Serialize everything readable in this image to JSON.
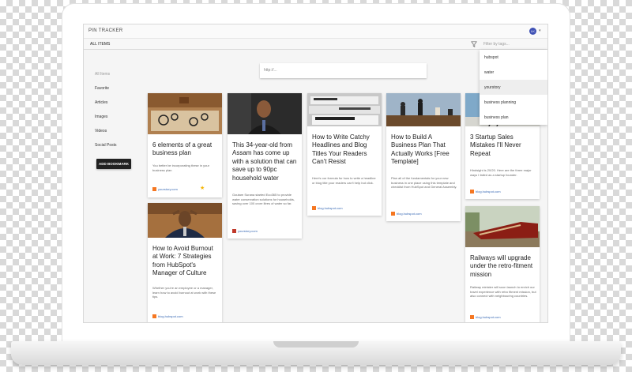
{
  "app": {
    "title": "PIN TRACKER",
    "avatar_initials": "LK",
    "tab_all": "ALL ITEMS"
  },
  "filter": {
    "placeholder": "Filter by tags...",
    "options": [
      "hubspot",
      "water",
      "yourstory",
      "business planning",
      "business plan"
    ],
    "highlighted": "yourstory"
  },
  "sidebar": {
    "items": [
      "All Items",
      "Favorite",
      "Articles",
      "Images",
      "Videos",
      "Social Posts"
    ],
    "add_button": "ADD BOOKMARK"
  },
  "url_input": {
    "placeholder": "http://..."
  },
  "cards": [
    {
      "title": "6 elements of a great business plan",
      "desc": "You better be incorporating these in your business plan",
      "source": "yourstory.com",
      "favorite": true,
      "image": "gears-sketch"
    },
    {
      "title": "This 34-year-old from Assam has come up with a solution that can save up to 90pc household water",
      "desc": "Goutam Surana started Eco365 to provide water conservation solutions for households, saving over 100 crore litres of water so far.",
      "source": "yourstory.com",
      "image": "man-portrait"
    },
    {
      "title": "How to Write Catchy Headlines and Blog Titles Your Readers Can't Resist",
      "desc": "Here's our formula for how to write a headline or blog title your readers can't help but click.",
      "source": "blog.hubspot.com",
      "image": "newspapers"
    },
    {
      "title": "How to Build A Business Plan That Actually Works [Free Template]",
      "desc": "Plan all of the fundamentals for your new business in one place using this template and checklist from HubSpot and General Assembly.",
      "source": "blog.hubspot.com",
      "image": "chess-pieces"
    },
    {
      "title": "3 Startup Sales Mistakes I'll Never Repeat",
      "desc": "Hindsight is 20/20. Here are the three major ways I failed as a startup founder.",
      "source": "blog.hubspot.com",
      "image": "ladder"
    },
    {
      "title": "How to Avoid Burnout at Work: 7 Strategies from HubSpot's Manager of Culture",
      "desc": "Whether you're an employee or a manager, learn how to avoid burnout at work with these tips.",
      "source": "blog.hubspot.com",
      "image": "stressed-man"
    },
    {
      "title": "Railways will upgrade under the retro-fitment mission",
      "desc": "Railway minister will soon launch to enrich our travel experience with retro fitment mission, but also connect with neighbouring countries.",
      "source": "blog.hubspot.com",
      "image": "train"
    }
  ]
}
